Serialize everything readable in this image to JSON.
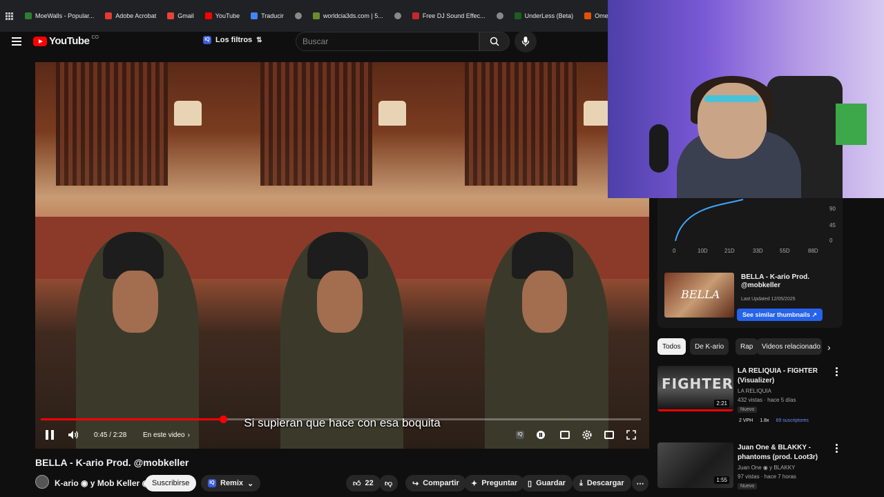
{
  "bookmarks": [
    {
      "label": "MoeWalls - Popular...",
      "color": "#2e7d32"
    },
    {
      "label": "Adobe Acrobat",
      "color": "#e53935"
    },
    {
      "label": "Gmail",
      "color": "#ea4335"
    },
    {
      "label": "YouTube",
      "color": "#ff0000"
    },
    {
      "label": "Traducir",
      "color": "#4285f4"
    },
    {
      "label": "worldcia3ds.com | 5...",
      "color": "#6d8b2e"
    },
    {
      "label": "",
      "color": "#888888"
    },
    {
      "label": "Free DJ Sound Effec...",
      "color": "#c62828"
    },
    {
      "label": "",
      "color": "#888888"
    },
    {
      "label": "UnderLess (Beta)",
      "color": "#1b5e20"
    },
    {
      "label": "OmeTV Video Chat...",
      "color": "#e65100"
    }
  ],
  "header": {
    "logo_text": "YouTube",
    "logo_country": "CO",
    "filters_label": "Los filtros",
    "search_placeholder": "Buscar"
  },
  "player": {
    "subtitle": "Si supieran que hace con esa boquita",
    "time": "0:45 / 2:28",
    "chapter": "En este video",
    "progress": 0.304
  },
  "video": {
    "title": "BELLA - K-ario Prod. @mobkeller",
    "channel": "K-ario ◉ y Mob Keller ◉",
    "subscribe_label": "Suscribirse",
    "remix_label": "Remix",
    "likes": "22",
    "share_label": "Compartir",
    "ask_label": "Preguntar",
    "save_label": "Guardar",
    "download_label": "Descargar"
  },
  "stats": {
    "y_ticks": [
      "90",
      "45",
      "0"
    ],
    "x_ticks": [
      "0",
      "10D",
      "21D",
      "33D",
      "55D",
      "88D"
    ],
    "line_color": "#3ea6ff"
  },
  "related_card": {
    "thumb_text": "BELLA",
    "title": "BELLA - K-ario Prod. @mobkeller",
    "updated": "Last Updated 12/05/2025",
    "button": "See similar thumbnails ↗"
  },
  "chips": [
    "Todos",
    "De K-ario",
    "Rap",
    "Videos relacionado"
  ],
  "recommendations": [
    {
      "title": "LA RELIQUIA - FIGHTER (Visualizer)",
      "channel": "LA RELIQUIA",
      "views": "432 vistas · hace 5 días",
      "badge": "Nuevo",
      "duration": "2:21",
      "thumb_text": "FIGHTER",
      "stat_vph": "2 VPH",
      "stat_x": "1.8x",
      "stat_subs": "69 suscriptores"
    },
    {
      "title": "Juan One & BLAKKY - phantoms (prod. Loot3r)",
      "channel": "Juan One ◉ y BLAKKY",
      "views": "97 vistas · hace 7 horas",
      "badge": "Nuevo",
      "duration": "1:55",
      "thumb_text": ""
    }
  ]
}
